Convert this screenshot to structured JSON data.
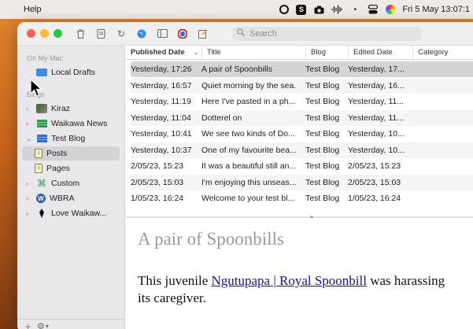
{
  "menubar": {
    "app_menu": "Help",
    "clock": "Fri 5 May  13:07:1",
    "status_icons": [
      "record-icon",
      "s-badge-icon",
      "camera-icon",
      "waveform-icon",
      "dot-icon",
      "control-center-icon",
      "color-wheel-icon"
    ]
  },
  "toolbar": {
    "search_placeholder": "Search",
    "buttons": [
      "trash-icon",
      "compose-icon",
      "refresh-icon",
      "globe-icon",
      "window-icon",
      "color-icon",
      "edit-icon"
    ]
  },
  "sidebar": {
    "sections": [
      {
        "header": "On My Mac",
        "items": [
          {
            "label": "Local Drafts",
            "icon": "folder-icon"
          }
        ]
      },
      {
        "header": "Blogs",
        "items": [
          {
            "label": "Kiraz",
            "icon": "avatar-icon",
            "expandable": true
          },
          {
            "label": "Waikawa News",
            "icon": "stack-green-icon",
            "expandable": true
          },
          {
            "label": "Test Blog",
            "icon": "stack-blue-icon",
            "expanded": true,
            "children": [
              {
                "label": "Posts",
                "icon": "page-icon",
                "selected": true
              },
              {
                "label": "Pages",
                "icon": "page-icon"
              }
            ]
          },
          {
            "label": "Custom",
            "icon": "command-icon",
            "expandable": true
          },
          {
            "label": "WBRA",
            "icon": "wordpress-icon",
            "expandable": true
          },
          {
            "label": "Love Waikaw...",
            "icon": "pen-icon",
            "expandable": true
          }
        ]
      }
    ],
    "bottom_add": "+",
    "bottom_gear": "⚙︎"
  },
  "table": {
    "columns": [
      "Published Date",
      "Title",
      "Blog",
      "Edited Date",
      "Category"
    ],
    "sort_indicator": "⌄",
    "rows": [
      {
        "published": "Yesterday, 17:26",
        "title": "A pair of Spoonbills",
        "blog": "Test Blog",
        "edited": "Yesterday, 17...",
        "category": "",
        "selected": true
      },
      {
        "published": "Yesterday, 16:57",
        "title": "Quiet morning by the sea.",
        "blog": "Test Blog",
        "edited": "Yesterday, 16...",
        "category": ""
      },
      {
        "published": "Yesterday, 11:19",
        "title": "Here I've pasted in a ph...",
        "blog": "Test Blog",
        "edited": "Yesterday, 11...",
        "category": ""
      },
      {
        "published": "Yesterday, 11:04",
        "title": "Dotterel on",
        "blog": "Test Blog",
        "edited": "Yesterday, 11...",
        "category": ""
      },
      {
        "published": "Yesterday, 10:41",
        "title": "We see two kinds of Do...",
        "blog": "Test Blog",
        "edited": "Yesterday, 10...",
        "category": ""
      },
      {
        "published": "Yesterday, 10:37",
        "title": "One of my favourite bea...",
        "blog": "Test Blog",
        "edited": "Yesterday, 10...",
        "category": ""
      },
      {
        "published": "2/05/23, 15:23",
        "title": "It was a beautiful still an...",
        "blog": "Test Blog",
        "edited": "2/05/23, 15:23",
        "category": ""
      },
      {
        "published": "2/05/23, 15:03",
        "title": "I'm enjoying this unseas...",
        "blog": "Test Blog",
        "edited": "2/05/23, 15:03",
        "category": ""
      },
      {
        "published": "1/05/23, 16:24",
        "title": "Welcome to your test bl...",
        "blog": "Test Blog",
        "edited": "1/05/23, 16:24",
        "category": ""
      }
    ]
  },
  "preview": {
    "title": "A pair of Spoonbills",
    "body_before": "This juvenile ",
    "link_text": "Ngutupapa | Royal Spoonbill",
    "body_after": " was harassing its caregiver."
  },
  "colors": {
    "close": "#fe5f57",
    "minimize": "#febc2e",
    "zoom": "#28c840",
    "selection": "#d4d4d4",
    "link": "#1a0dab"
  }
}
